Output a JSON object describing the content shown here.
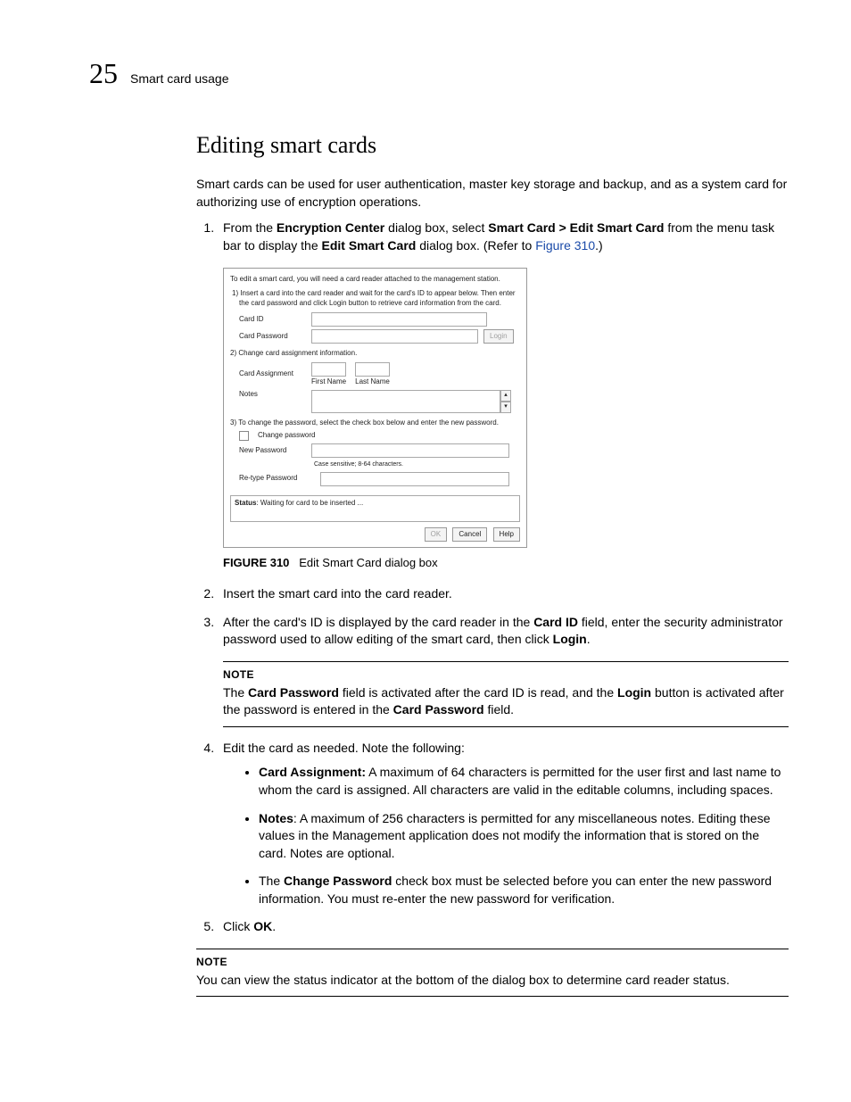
{
  "header": {
    "page_number": "25",
    "running_title": "Smart card usage"
  },
  "heading": "Editing smart cards",
  "intro": "Smart cards can be used for user authentication, master key storage and backup, and as a system card for authorizing use of encryption operations.",
  "steps": {
    "s1_pre": "From the ",
    "s1_b1": "Encryption Center",
    "s1_mid1": " dialog box, select ",
    "s1_b2": "Smart Card > Edit Smart Card",
    "s1_mid2": " from the menu task bar to display the ",
    "s1_b3": "Edit Smart Card",
    "s1_post": " dialog box. (Refer to ",
    "s1_link": "Figure 310",
    "s1_end": ".)",
    "s2": "Insert the smart card into the card reader.",
    "s3_pre": "After the card's ID is displayed by the card reader in the ",
    "s3_b1": "Card ID",
    "s3_mid": " field, enter the security administrator password used to allow editing of the smart card, then click ",
    "s3_b2": "Login",
    "s3_end": ".",
    "s4": "Edit the card as needed. Note the following:",
    "s5_pre": "Click ",
    "s5_b1": "OK",
    "s5_end": "."
  },
  "bullets": {
    "b1_lbl": "Card Assignment:",
    "b1_txt": " A maximum of 64 characters is permitted for the user first and last name to whom the card is assigned. All characters are valid in the editable columns, including spaces.",
    "b2_lbl": "Notes",
    "b2_txt": ": A maximum of 256 characters is permitted for any miscellaneous notes. Editing these values in the Management application does not modify the information that is stored on the card. Notes are optional.",
    "b3_pre": "The ",
    "b3_lbl": "Change Password",
    "b3_txt": " check box must be selected before you can enter the new password information. You must re-enter the new password for verification."
  },
  "note1": {
    "label": "NOTE",
    "t1": "The ",
    "b1": "Card Password",
    "t2": " field is activated after the card ID is read, and the ",
    "b2": "Login",
    "t3": " button is activated after the password is entered in the ",
    "b3": "Card Password",
    "t4": " field."
  },
  "note2": {
    "label": "NOTE",
    "text": "You can view the status indicator at the bottom of the dialog box to determine card reader status."
  },
  "figure": {
    "num": "FIGURE 310",
    "caption": "Edit Smart Card dialog box"
  },
  "dialog": {
    "hint": "To edit a smart card, you will need a card reader attached to the management station.",
    "step1": "1) Insert a card into the card reader and wait for the card's ID to appear below. Then enter the card password and click Login button to retrieve card information from the card.",
    "card_id_lbl": "Card ID",
    "card_pw_lbl": "Card Password",
    "login_btn": "Login",
    "step2": "2) Change card assignment information.",
    "assign_lbl": "Card Assignment",
    "first_name": "First Name",
    "last_name": "Last Name",
    "notes_lbl": "Notes",
    "step3": "3) To change the password, select the check box below and enter the new password.",
    "change_pw_lbl": "Change password",
    "new_pw_lbl": "New Password",
    "pw_note": "Case sensitive; 8-64 characters.",
    "retype_lbl": "Re-type Password",
    "status_lbl": "Status",
    "status_val": ": Waiting for card to be inserted ...",
    "ok": "OK",
    "cancel": "Cancel",
    "help": "Help"
  }
}
